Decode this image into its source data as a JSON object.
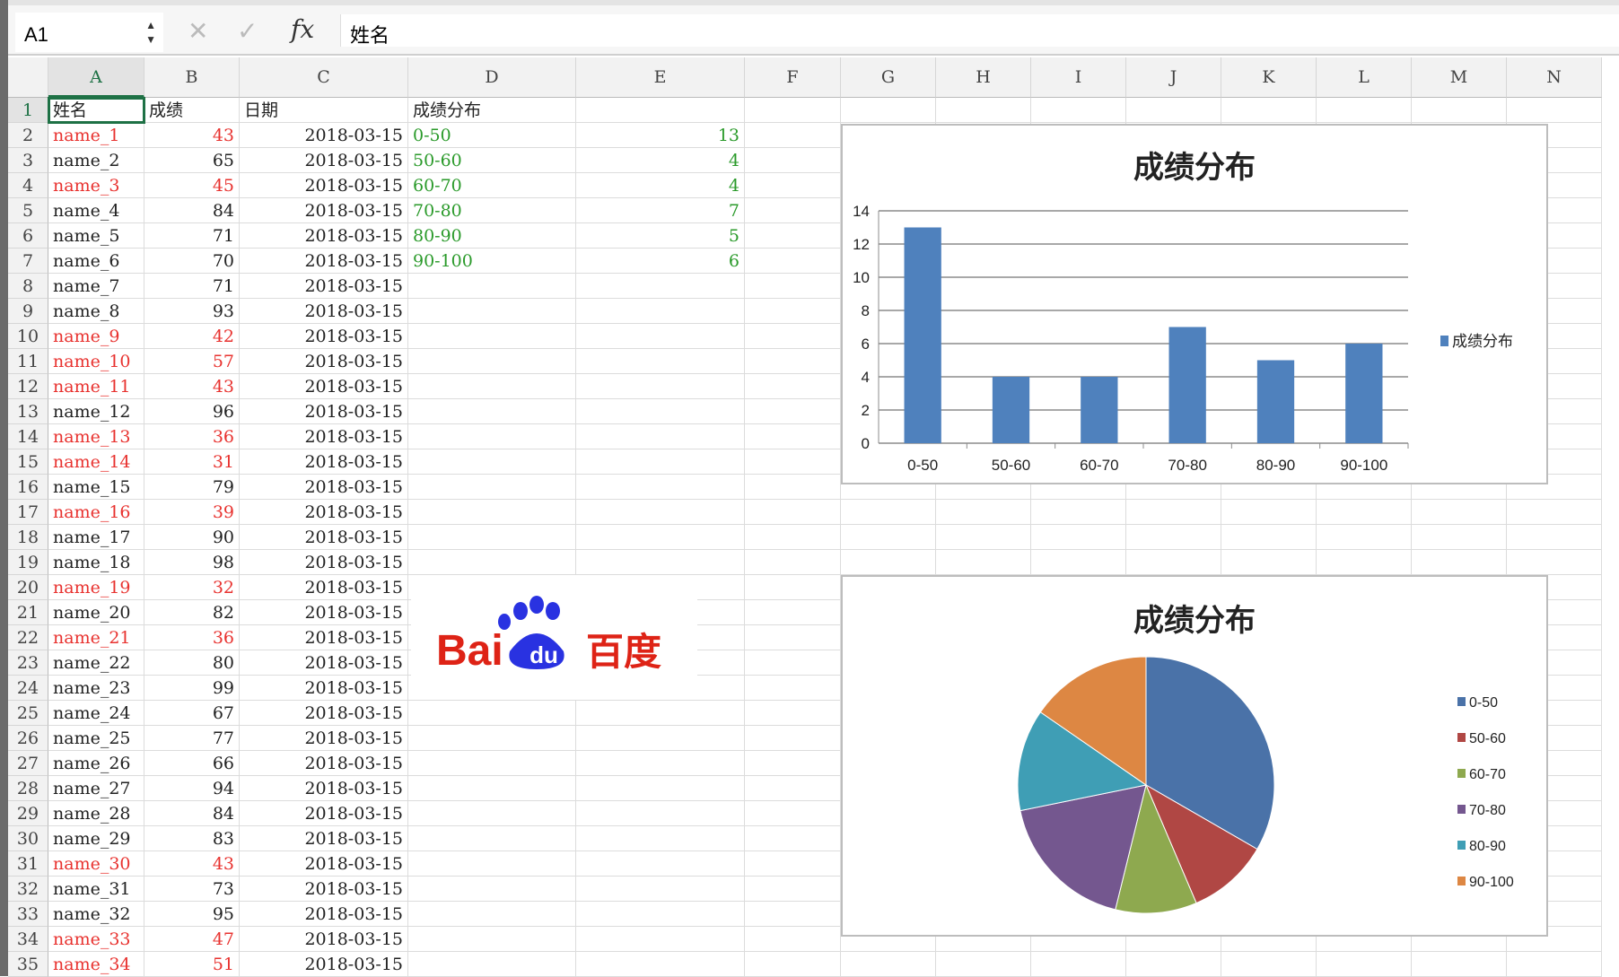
{
  "formula_bar": {
    "name_box": "A1",
    "cancel_icon": "✕",
    "confirm_icon": "✓",
    "fx_label": "fx",
    "formula": "姓名"
  },
  "columns": [
    "A",
    "B",
    "C",
    "D",
    "E",
    "F",
    "G",
    "H",
    "I",
    "J",
    "K",
    "L",
    "M",
    "N"
  ],
  "header_row": {
    "name": "姓名",
    "score": "成绩",
    "date": "日期",
    "dist": "成绩分布"
  },
  "students": [
    [
      "name_1",
      43
    ],
    [
      "name_2",
      65
    ],
    [
      "name_3",
      45
    ],
    [
      "name_4",
      84
    ],
    [
      "name_5",
      71
    ],
    [
      "name_6",
      70
    ],
    [
      "name_7",
      71
    ],
    [
      "name_8",
      93
    ],
    [
      "name_9",
      42
    ],
    [
      "name_10",
      57
    ],
    [
      "name_11",
      43
    ],
    [
      "name_12",
      96
    ],
    [
      "name_13",
      36
    ],
    [
      "name_14",
      31
    ],
    [
      "name_15",
      79
    ],
    [
      "name_16",
      39
    ],
    [
      "name_17",
      90
    ],
    [
      "name_18",
      98
    ],
    [
      "name_19",
      32
    ],
    [
      "name_20",
      82
    ],
    [
      "name_21",
      36
    ],
    [
      "name_22",
      80
    ],
    [
      "name_23",
      99
    ],
    [
      "name_24",
      67
    ],
    [
      "name_25",
      77
    ],
    [
      "name_26",
      66
    ],
    [
      "name_27",
      94
    ],
    [
      "name_28",
      84
    ],
    [
      "name_29",
      83
    ],
    [
      "name_30",
      43
    ],
    [
      "name_31",
      73
    ],
    [
      "name_32",
      95
    ],
    [
      "name_33",
      47
    ],
    [
      "name_34",
      51
    ]
  ],
  "date_value": "2018-03-15",
  "distribution": [
    [
      "0-50",
      13
    ],
    [
      "50-60",
      4
    ],
    [
      "60-70",
      4
    ],
    [
      "70-80",
      7
    ],
    [
      "80-90",
      5
    ],
    [
      "90-100",
      6
    ]
  ],
  "colors": {
    "fail_text": "#e8322f",
    "dist_text": "#2a9a2a",
    "selection": "#1e7145",
    "bar": "#4f81bd"
  },
  "logo": {
    "text": "Bai du 百度"
  },
  "chart_data": [
    {
      "type": "bar",
      "title": "成绩分布",
      "categories": [
        "0-50",
        "50-60",
        "60-70",
        "70-80",
        "80-90",
        "90-100"
      ],
      "series": [
        {
          "name": "成绩分布",
          "values": [
            13,
            4,
            4,
            7,
            5,
            6
          ]
        }
      ],
      "ylim": [
        0,
        14
      ],
      "yticks": [
        0,
        2,
        4,
        6,
        8,
        10,
        12,
        14
      ],
      "grid": true,
      "legend": "right"
    },
    {
      "type": "pie",
      "title": "成绩分布",
      "categories": [
        "0-50",
        "50-60",
        "60-70",
        "70-80",
        "80-90",
        "90-100"
      ],
      "values": [
        13,
        4,
        4,
        7,
        5,
        6
      ],
      "colors": [
        "#4a72a8",
        "#b04744",
        "#8ea94f",
        "#74578f",
        "#3f9eb5",
        "#dd8743"
      ],
      "legend": "right"
    }
  ]
}
